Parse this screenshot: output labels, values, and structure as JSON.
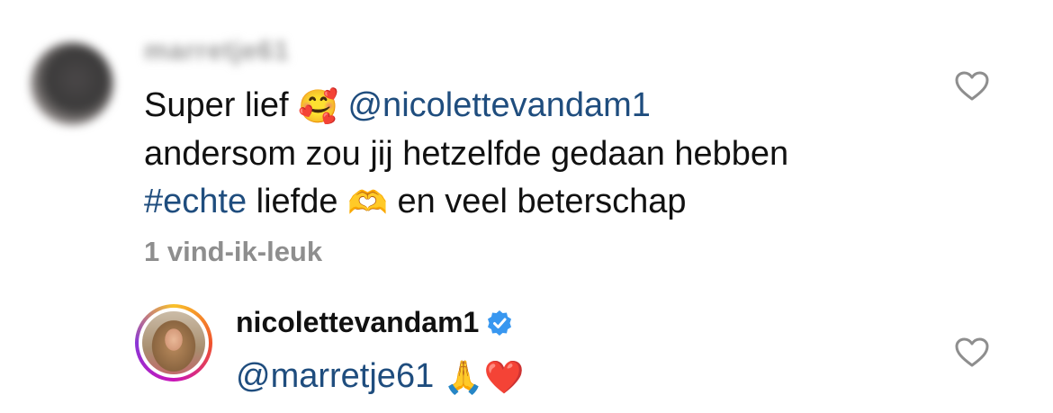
{
  "comment": {
    "username": "marretje61",
    "text_part1": "Super lief ",
    "emoji_smile": "🥰",
    "mention": "@nicolettevandam1",
    "text_line2": "andersom zou jij hetzelfde gedaan hebben",
    "hashtag": "#echte",
    "text_part3": " liefde ",
    "emoji_hands": "🫶",
    "text_part4": " en veel beterschap",
    "likes": "1 vind-ik-leuk"
  },
  "reply": {
    "username": "nicolettevandam1",
    "mention": "@marretje61",
    "emoji_pray": "🙏",
    "emoji_heart": "❤️"
  },
  "colors": {
    "mention": "#1f4d7e",
    "likes": "#8e8e8e",
    "verified": "#3897f0",
    "heart_heart": "#d4202c"
  },
  "icons": {
    "like": "heart-outline-icon",
    "verified": "verified-badge-icon"
  }
}
